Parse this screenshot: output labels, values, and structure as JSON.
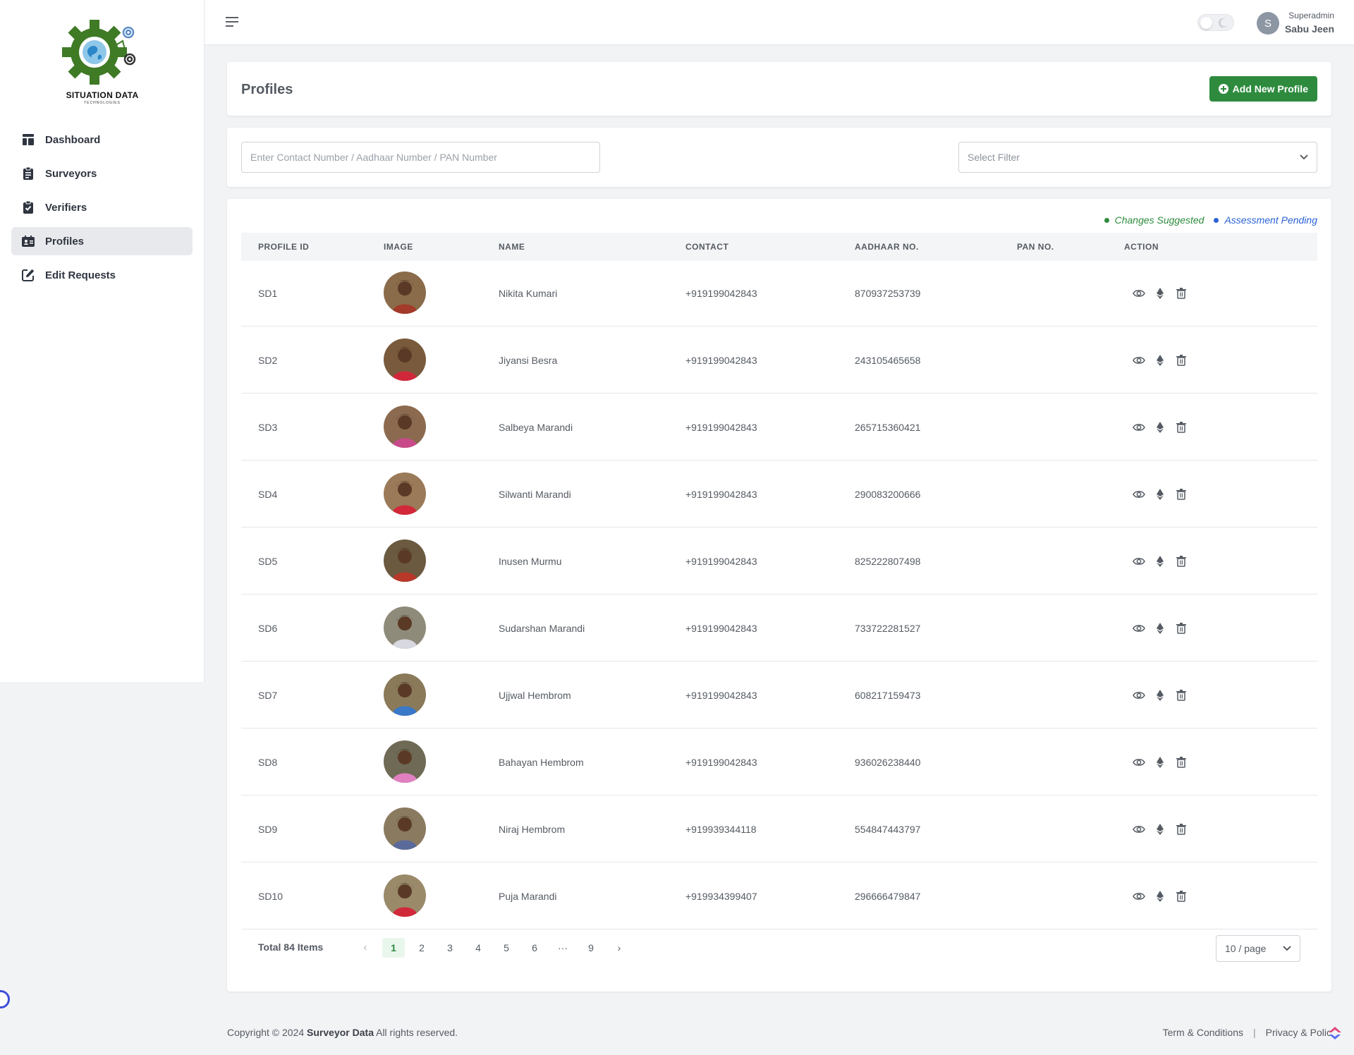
{
  "brand": {
    "title": "SITUATION DATA",
    "subtitle": "TECHNOLOGIES"
  },
  "sidebar": {
    "items": [
      {
        "label": "Dashboard",
        "icon": "dashboard-icon",
        "active": false
      },
      {
        "label": "Surveyors",
        "icon": "clipboard-list-icon",
        "active": false
      },
      {
        "label": "Verifiers",
        "icon": "clipboard-check-icon",
        "active": false
      },
      {
        "label": "Profiles",
        "icon": "id-card-icon",
        "active": true
      },
      {
        "label": "Edit Requests",
        "icon": "edit-icon",
        "active": false
      }
    ]
  },
  "header": {
    "role": "Superadmin",
    "user_name": "Sabu Jeen",
    "avatar_letter": "S"
  },
  "page": {
    "title": "Profiles",
    "add_button": "Add New Profile"
  },
  "filters": {
    "search_placeholder": "Enter Contact Number / Aadhaar Number / PAN Number",
    "select_placeholder": "Select Filter"
  },
  "legend": {
    "changes_suggested": "Changes Suggested",
    "assessment_pending": "Assessment Pending",
    "changes_color": "#2e8b3e",
    "pending_color": "#2a62d6"
  },
  "table": {
    "headers": [
      "PROFILE ID",
      "IMAGE",
      "NAME",
      "CONTACT",
      "AADHAAR NO.",
      "PAN NO.",
      "ACTION"
    ],
    "rows": [
      {
        "id": "SD1",
        "name": "Nikita Kumari",
        "contact": "+919199042843",
        "aadhaar": "870937253739",
        "pan": ""
      },
      {
        "id": "SD2",
        "name": "Jiyansi Besra",
        "contact": "+919199042843",
        "aadhaar": "243105465658",
        "pan": ""
      },
      {
        "id": "SD3",
        "name": "Salbeya Marandi",
        "contact": "+919199042843",
        "aadhaar": "265715360421",
        "pan": ""
      },
      {
        "id": "SD4",
        "name": "Silwanti Marandi",
        "contact": "+919199042843",
        "aadhaar": "290083200666",
        "pan": ""
      },
      {
        "id": "SD5",
        "name": "Inusen Murmu",
        "contact": "+919199042843",
        "aadhaar": "825222807498",
        "pan": ""
      },
      {
        "id": "SD6",
        "name": "Sudarshan Marandi",
        "contact": "+919199042843",
        "aadhaar": "733722281527",
        "pan": ""
      },
      {
        "id": "SD7",
        "name": "Ujjwal Hembrom",
        "contact": "+919199042843",
        "aadhaar": "608217159473",
        "pan": ""
      },
      {
        "id": "SD8",
        "name": "Bahayan Hembrom",
        "contact": "+919199042843",
        "aadhaar": "936026238440",
        "pan": ""
      },
      {
        "id": "SD9",
        "name": "Niraj Hembrom",
        "contact": "+919939344118",
        "aadhaar": "554847443797",
        "pan": ""
      },
      {
        "id": "SD10",
        "name": "Puja Marandi",
        "contact": "+919934399407",
        "aadhaar": "296666479847",
        "pan": ""
      }
    ]
  },
  "pagination": {
    "total": "Total 84 Items",
    "pages": [
      "1",
      "2",
      "3",
      "4",
      "5",
      "6",
      "···",
      "9"
    ],
    "current": "1",
    "per_page": "10 / page"
  },
  "footer": {
    "prefix": "Copyright © 2024",
    "company": "Surveyor Data",
    "suffix": "All rights reserved.",
    "terms": "Term & Conditions",
    "separator": "|",
    "privacy": "Privacy & Polic"
  }
}
